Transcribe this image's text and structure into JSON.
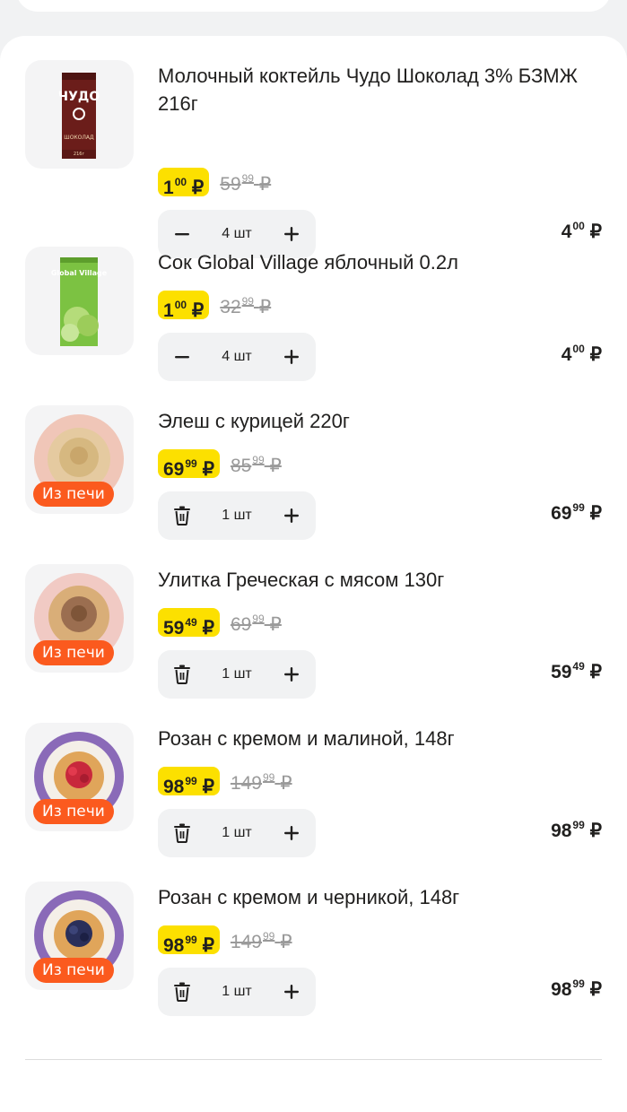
{
  "currency": "₽",
  "items": [
    {
      "title": "Молочный коктейль Чудо Шоколад 3% БЗМЖ 216г",
      "price_main": "1",
      "price_cents": "00",
      "old_main": "59",
      "old_cents": "99",
      "qty": "4 шт",
      "total_main": "4",
      "total_cents": "00",
      "badge": "",
      "image": "chocolate-milk-carton",
      "decrement": "minus-icon"
    },
    {
      "title": "Сок Global Village яблочный 0.2л",
      "price_main": "1",
      "price_cents": "00",
      "old_main": "32",
      "old_cents": "99",
      "qty": "4 шт",
      "total_main": "4",
      "total_cents": "00",
      "badge": "",
      "image": "apple-juice-carton",
      "decrement": "minus-icon"
    },
    {
      "title": "Элеш с курицей 220г",
      "price_main": "69",
      "price_cents": "99",
      "old_main": "85",
      "old_cents": "99",
      "qty": "1 шт",
      "total_main": "69",
      "total_cents": "99",
      "badge": "Из печи",
      "image": "chicken-pie",
      "decrement": "trash-icon"
    },
    {
      "title": "Улитка Греческая с мясом 130г",
      "price_main": "59",
      "price_cents": "49",
      "old_main": "69",
      "old_cents": "99",
      "qty": "1 шт",
      "total_main": "59",
      "total_cents": "49",
      "badge": "Из печи",
      "image": "meat-pastry",
      "decrement": "trash-icon"
    },
    {
      "title": "Розан с кремом и малиной, 148г",
      "price_main": "98",
      "price_cents": "99",
      "old_main": "149",
      "old_cents": "99",
      "qty": "1 шт",
      "total_main": "98",
      "total_cents": "99",
      "badge": "Из печи",
      "image": "raspberry-pastry",
      "decrement": "trash-icon"
    },
    {
      "title": "Розан с кремом и черникой, 148г",
      "price_main": "98",
      "price_cents": "99",
      "old_main": "149",
      "old_cents": "99",
      "qty": "1 шт",
      "total_main": "98",
      "total_cents": "99",
      "badge": "Из печи",
      "image": "blueberry-pastry",
      "decrement": "trash-icon"
    }
  ],
  "carton_labels": {
    "chudo": "ЧУДО",
    "chudo_flavor": "ШОКОЛАД",
    "chudo_volume": "216г",
    "global_village": "Global Village"
  },
  "colors": {
    "price_highlight": "#fce000",
    "badge": "#fb5a1e",
    "stepper_bg": "#f1f2f3"
  }
}
